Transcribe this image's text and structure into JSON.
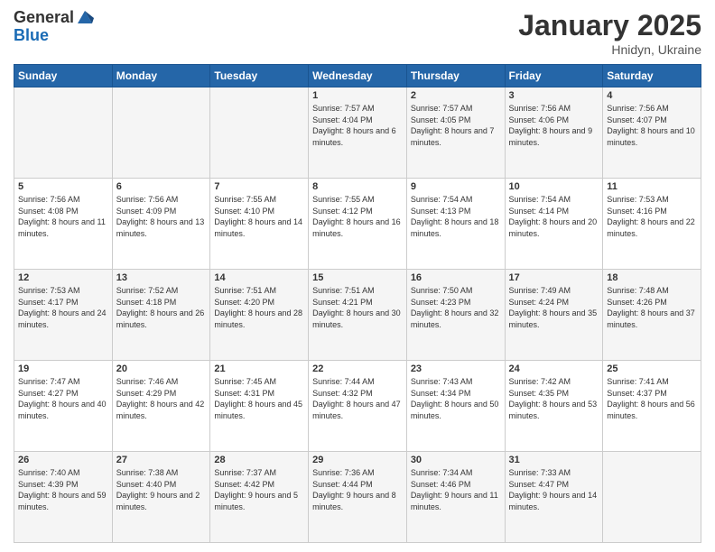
{
  "header": {
    "logo_general": "General",
    "logo_blue": "Blue",
    "month_year": "January 2025",
    "location": "Hnidyn, Ukraine"
  },
  "weekdays": [
    "Sunday",
    "Monday",
    "Tuesday",
    "Wednesday",
    "Thursday",
    "Friday",
    "Saturday"
  ],
  "weeks": [
    [
      {
        "day": "",
        "info": ""
      },
      {
        "day": "",
        "info": ""
      },
      {
        "day": "",
        "info": ""
      },
      {
        "day": "1",
        "info": "Sunrise: 7:57 AM\nSunset: 4:04 PM\nDaylight: 8 hours and 6 minutes."
      },
      {
        "day": "2",
        "info": "Sunrise: 7:57 AM\nSunset: 4:05 PM\nDaylight: 8 hours and 7 minutes."
      },
      {
        "day": "3",
        "info": "Sunrise: 7:56 AM\nSunset: 4:06 PM\nDaylight: 8 hours and 9 minutes."
      },
      {
        "day": "4",
        "info": "Sunrise: 7:56 AM\nSunset: 4:07 PM\nDaylight: 8 hours and 10 minutes."
      }
    ],
    [
      {
        "day": "5",
        "info": "Sunrise: 7:56 AM\nSunset: 4:08 PM\nDaylight: 8 hours and 11 minutes."
      },
      {
        "day": "6",
        "info": "Sunrise: 7:56 AM\nSunset: 4:09 PM\nDaylight: 8 hours and 13 minutes."
      },
      {
        "day": "7",
        "info": "Sunrise: 7:55 AM\nSunset: 4:10 PM\nDaylight: 8 hours and 14 minutes."
      },
      {
        "day": "8",
        "info": "Sunrise: 7:55 AM\nSunset: 4:12 PM\nDaylight: 8 hours and 16 minutes."
      },
      {
        "day": "9",
        "info": "Sunrise: 7:54 AM\nSunset: 4:13 PM\nDaylight: 8 hours and 18 minutes."
      },
      {
        "day": "10",
        "info": "Sunrise: 7:54 AM\nSunset: 4:14 PM\nDaylight: 8 hours and 20 minutes."
      },
      {
        "day": "11",
        "info": "Sunrise: 7:53 AM\nSunset: 4:16 PM\nDaylight: 8 hours and 22 minutes."
      }
    ],
    [
      {
        "day": "12",
        "info": "Sunrise: 7:53 AM\nSunset: 4:17 PM\nDaylight: 8 hours and 24 minutes."
      },
      {
        "day": "13",
        "info": "Sunrise: 7:52 AM\nSunset: 4:18 PM\nDaylight: 8 hours and 26 minutes."
      },
      {
        "day": "14",
        "info": "Sunrise: 7:51 AM\nSunset: 4:20 PM\nDaylight: 8 hours and 28 minutes."
      },
      {
        "day": "15",
        "info": "Sunrise: 7:51 AM\nSunset: 4:21 PM\nDaylight: 8 hours and 30 minutes."
      },
      {
        "day": "16",
        "info": "Sunrise: 7:50 AM\nSunset: 4:23 PM\nDaylight: 8 hours and 32 minutes."
      },
      {
        "day": "17",
        "info": "Sunrise: 7:49 AM\nSunset: 4:24 PM\nDaylight: 8 hours and 35 minutes."
      },
      {
        "day": "18",
        "info": "Sunrise: 7:48 AM\nSunset: 4:26 PM\nDaylight: 8 hours and 37 minutes."
      }
    ],
    [
      {
        "day": "19",
        "info": "Sunrise: 7:47 AM\nSunset: 4:27 PM\nDaylight: 8 hours and 40 minutes."
      },
      {
        "day": "20",
        "info": "Sunrise: 7:46 AM\nSunset: 4:29 PM\nDaylight: 8 hours and 42 minutes."
      },
      {
        "day": "21",
        "info": "Sunrise: 7:45 AM\nSunset: 4:31 PM\nDaylight: 8 hours and 45 minutes."
      },
      {
        "day": "22",
        "info": "Sunrise: 7:44 AM\nSunset: 4:32 PM\nDaylight: 8 hours and 47 minutes."
      },
      {
        "day": "23",
        "info": "Sunrise: 7:43 AM\nSunset: 4:34 PM\nDaylight: 8 hours and 50 minutes."
      },
      {
        "day": "24",
        "info": "Sunrise: 7:42 AM\nSunset: 4:35 PM\nDaylight: 8 hours and 53 minutes."
      },
      {
        "day": "25",
        "info": "Sunrise: 7:41 AM\nSunset: 4:37 PM\nDaylight: 8 hours and 56 minutes."
      }
    ],
    [
      {
        "day": "26",
        "info": "Sunrise: 7:40 AM\nSunset: 4:39 PM\nDaylight: 8 hours and 59 minutes."
      },
      {
        "day": "27",
        "info": "Sunrise: 7:38 AM\nSunset: 4:40 PM\nDaylight: 9 hours and 2 minutes."
      },
      {
        "day": "28",
        "info": "Sunrise: 7:37 AM\nSunset: 4:42 PM\nDaylight: 9 hours and 5 minutes."
      },
      {
        "day": "29",
        "info": "Sunrise: 7:36 AM\nSunset: 4:44 PM\nDaylight: 9 hours and 8 minutes."
      },
      {
        "day": "30",
        "info": "Sunrise: 7:34 AM\nSunset: 4:46 PM\nDaylight: 9 hours and 11 minutes."
      },
      {
        "day": "31",
        "info": "Sunrise: 7:33 AM\nSunset: 4:47 PM\nDaylight: 9 hours and 14 minutes."
      },
      {
        "day": "",
        "info": ""
      }
    ]
  ]
}
